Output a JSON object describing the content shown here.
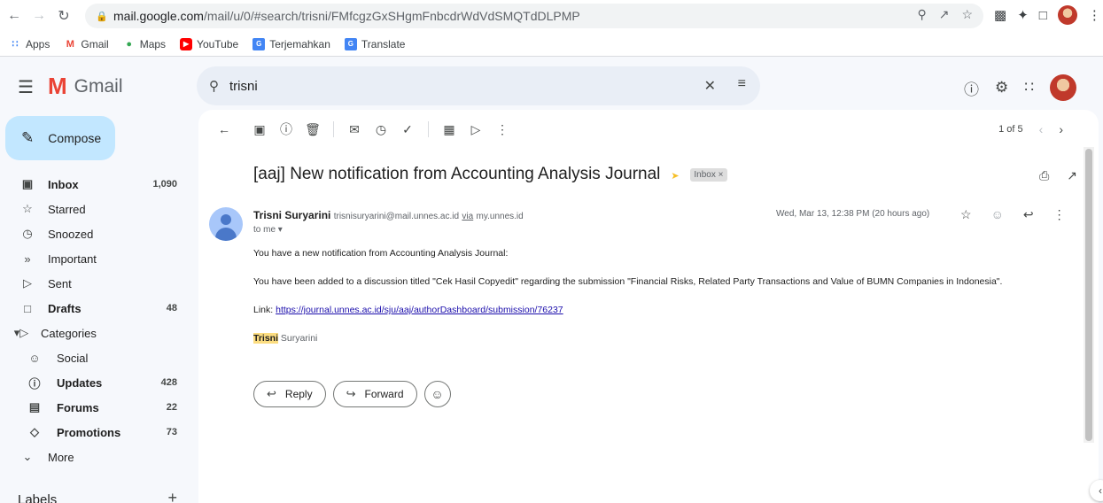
{
  "browser": {
    "url_host": "mail.google.com",
    "url_path": "/mail/u/0/#search/trisni/FMfcgzGxSHgmFnbcdrWdVdSMQTdDLPMP",
    "bookmarks": [
      {
        "label": "Apps",
        "icon": "apps-grid-icon"
      },
      {
        "label": "Gmail",
        "icon": "gmail-icon"
      },
      {
        "label": "Maps",
        "icon": "maps-pin-icon"
      },
      {
        "label": "YouTube",
        "icon": "youtube-icon"
      },
      {
        "label": "Terjemahkan",
        "icon": "translate-icon"
      },
      {
        "label": "Translate",
        "icon": "translate-icon"
      }
    ]
  },
  "gmail": {
    "logo_text": "Gmail",
    "search_value": "trisni",
    "compose_label": "Compose",
    "nav": [
      {
        "label": "Inbox",
        "count": "1,090",
        "icon": "inbox-icon",
        "bold": true
      },
      {
        "label": "Starred",
        "count": "",
        "icon": "star-icon"
      },
      {
        "label": "Snoozed",
        "count": "",
        "icon": "clock-icon"
      },
      {
        "label": "Important",
        "count": "",
        "icon": "important-icon"
      },
      {
        "label": "Sent",
        "count": "",
        "icon": "sent-icon"
      },
      {
        "label": "Drafts",
        "count": "48",
        "icon": "draft-icon",
        "bold": true
      },
      {
        "label": "Categories",
        "count": "",
        "icon": "label-icon"
      },
      {
        "label": "Social",
        "count": "",
        "icon": "social-icon"
      },
      {
        "label": "Updates",
        "count": "428",
        "icon": "info-icon",
        "bold": true
      },
      {
        "label": "Forums",
        "count": "22",
        "icon": "forum-icon",
        "bold": true
      },
      {
        "label": "Promotions",
        "count": "73",
        "icon": "tag-icon",
        "bold": true
      },
      {
        "label": "More",
        "count": "",
        "icon": "chevron-down-icon"
      }
    ],
    "labels_heading": "Labels"
  },
  "message": {
    "pager_text": "1 of 5",
    "subject": "[aaj] New notification from Accounting Analysis Journal",
    "tag": "Inbox",
    "sender_name": "Trisni Suryarini",
    "sender_email": "trisnisuryarini@mail.unnes.ac.id",
    "via_word": "via",
    "via_domain": "my.unnes.id",
    "to": "to me",
    "date": "Wed, Mar 13, 12:38 PM (20 hours ago)",
    "line1": "You have a new notification from Accounting Analysis Journal:",
    "line2": "You have been added to a discussion titled \"Cek Hasil Copyedit\" regarding the submission \"Financial Risks, Related Party Transactions and Value of BUMN Companies in Indonesia\".",
    "link_prefix": "Link: ",
    "link_url": "https://journal.unnes.ac.id/sju/aaj/authorDashboard/submission/76237",
    "sig_first": "Trisni",
    "sig_last": " Suryarini",
    "reply_label": "Reply",
    "forward_label": "Forward"
  },
  "colors": {
    "compose_bg": "#c2e7ff",
    "search_bg": "#e9eef6",
    "highlight": "#fcdd80",
    "link": "#1a0dab"
  }
}
